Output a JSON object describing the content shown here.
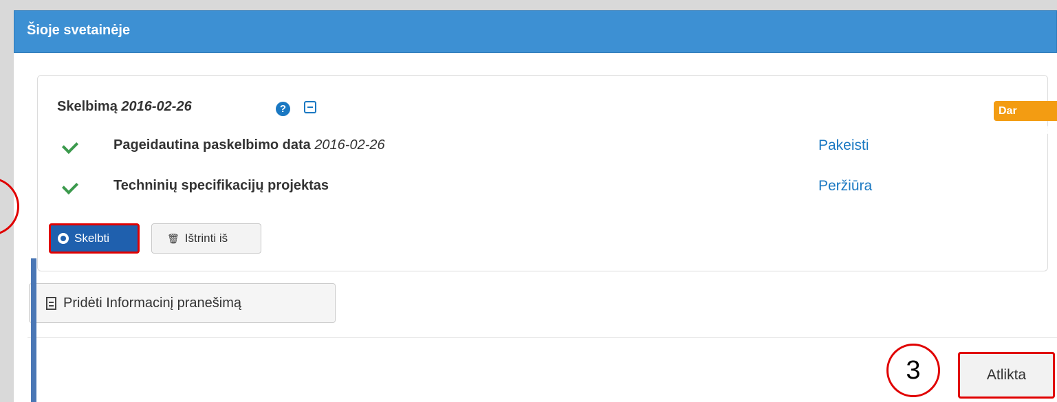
{
  "panel": {
    "title": "Šioje svetainėje"
  },
  "card": {
    "title_label": "Skelbimą",
    "title_date": "2016-02-26",
    "help_glyph": "?",
    "status": "Dar nepaskelbta",
    "rows": [
      {
        "label": "Pageidautina paskelbimo data",
        "value": "2016-02-26",
        "link": "Pakeisti"
      },
      {
        "label": "Techninių specifikacijų projektas",
        "link": "Peržiūra"
      }
    ],
    "publish_button": "Skelbti",
    "delete_button": "Ištrinti iš"
  },
  "add_button": "Pridėti Informacinį pranešimą",
  "done_button": "Atlikta",
  "annotation": {
    "step": "3"
  },
  "colors": {
    "header_blue": "#3d90d3",
    "link_blue": "#1a78c2",
    "badge_orange": "#f39c12",
    "check_green": "#3c9a4d",
    "highlight_red": "#e00000"
  }
}
